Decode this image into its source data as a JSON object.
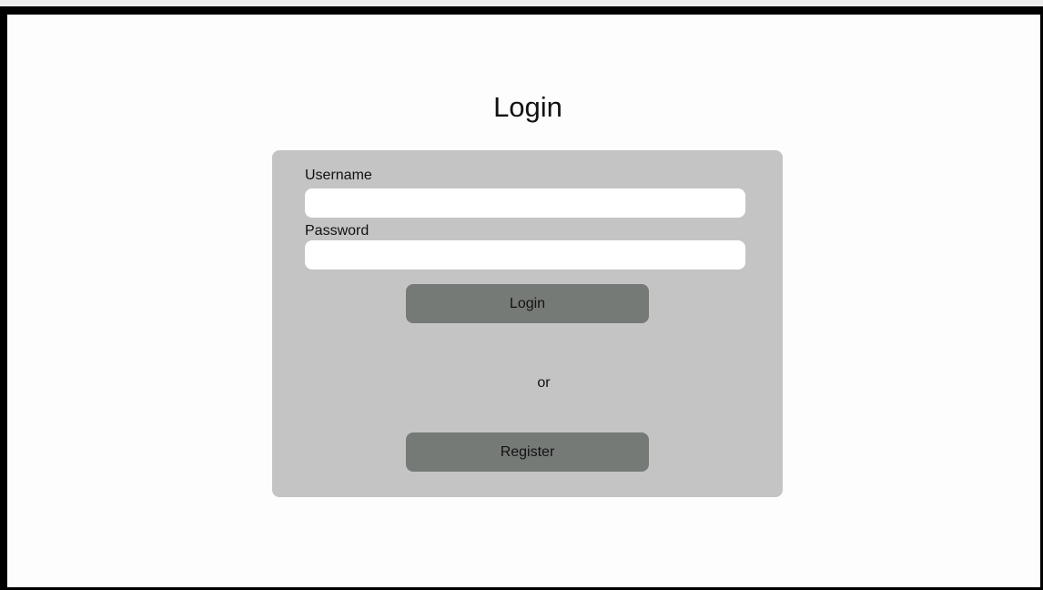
{
  "page": {
    "title": "Login"
  },
  "form": {
    "username_label": "Username",
    "username_value": "",
    "username_placeholder": "",
    "password_label": "Password",
    "password_value": "",
    "password_placeholder": "",
    "login_button": "Login",
    "separator": "or",
    "register_button": "Register"
  },
  "colors": {
    "card_background": "#c4c4c4",
    "button_background": "#767a77",
    "frame_border": "#000000",
    "input_background": "#ffffff"
  }
}
